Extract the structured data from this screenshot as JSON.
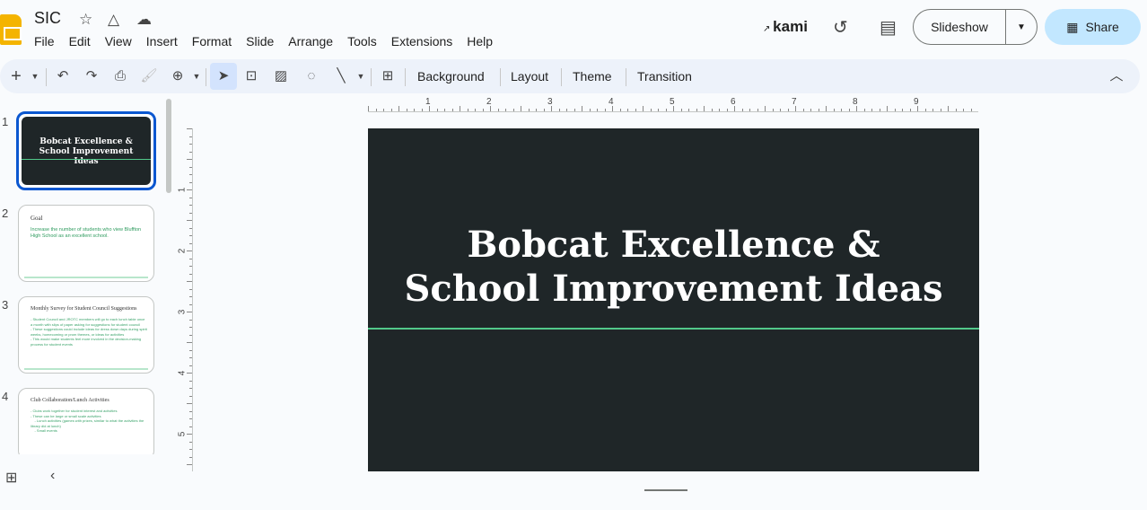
{
  "app": {
    "title": "SIC",
    "icons": [
      "star-icon",
      "add-to-drive-icon",
      "cloud-saved-icon"
    ]
  },
  "menu": [
    "File",
    "Edit",
    "View",
    "Insert",
    "Format",
    "Slide",
    "Arrange",
    "Tools",
    "Extensions",
    "Help"
  ],
  "header": {
    "kami": "kami",
    "slideshow": "Slideshow",
    "share": "Share"
  },
  "toolbar": {
    "background": "Background",
    "layout": "Layout",
    "theme": "Theme",
    "transition": "Transition"
  },
  "slides": [
    {
      "num": "1",
      "title": "Bobcat Excellence & School Improvement Ideas"
    },
    {
      "num": "2",
      "title": "Goal",
      "body": "Increase the number of students who view Bluffton High School as an excellent school."
    },
    {
      "num": "3",
      "title": "Monthly Survey for Student Council Suggestions",
      "body": "- Student Council and JROTC members will go to each lunch table once a month with slips of paper asking for suggestions for student council\n- These suggestions could include ideas for dress down days during spirit weeks, homecoming or prom themes, or ideas for activities\n- This would make students feel more involved in the decision-making process for student events"
    },
    {
      "num": "4",
      "title": "Club Collaboration/Lunch Activities",
      "body": "- Clubs work together for student interest and activities\n- These can be large or small scale activities\n    - Lunch activities (games with prizes, similar to what the activities the library did at lunch)\n    - Small events"
    }
  ],
  "ruler": {
    "h": [
      "1",
      "2",
      "3",
      "4",
      "5",
      "6",
      "7",
      "8",
      "9"
    ],
    "v": [
      "1",
      "2",
      "3",
      "4",
      "5"
    ]
  },
  "current_slide": {
    "title_line1": "Bobcat Excellence &",
    "title_line2": "School Improvement Ideas"
  },
  "colors": {
    "slide_bg": "#1f2628",
    "accent_line": "#52c98a",
    "share_bg": "#c2e7ff",
    "selection": "#0b57d0"
  }
}
